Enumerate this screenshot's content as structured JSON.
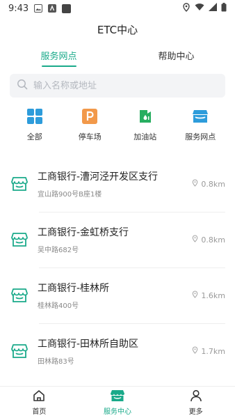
{
  "status_bar": {
    "time": "9:43"
  },
  "app": {
    "title": "ETC中心"
  },
  "tabs": [
    {
      "label": "服务网点",
      "active": true
    },
    {
      "label": "帮助中心",
      "active": false
    }
  ],
  "search": {
    "placeholder": "输入名称或地址",
    "value": ""
  },
  "categories": [
    {
      "label": "全部",
      "icon": "grid-icon",
      "color": "#2d9cdb"
    },
    {
      "label": "停车场",
      "icon": "parking-icon",
      "color": "#f2994a"
    },
    {
      "label": "加油站",
      "icon": "gas-station-icon",
      "color": "#27ae60"
    },
    {
      "label": "服务网点",
      "icon": "store-icon",
      "color": "#2d9cdb"
    }
  ],
  "outlets": [
    {
      "name": "工商银行-漕河泾开发区支行",
      "address": "宜山路900号B座1楼",
      "distance": "0.8km"
    },
    {
      "name": "工商银行-金虹桥支行",
      "address": "吴中路682号",
      "distance": "0.8km"
    },
    {
      "name": "工商银行-桂林所",
      "address": "桂林路400号",
      "distance": "1.6km"
    },
    {
      "name": "工商银行-田林所自助区",
      "address": "田林路83号",
      "distance": "1.7km"
    }
  ],
  "bottom_nav": [
    {
      "label": "首页",
      "icon": "home-icon",
      "active": false
    },
    {
      "label": "服务中心",
      "icon": "service-center-icon",
      "active": true
    },
    {
      "label": "更多",
      "icon": "person-icon",
      "active": false
    }
  ],
  "colors": {
    "accent": "#1aaa8a"
  }
}
